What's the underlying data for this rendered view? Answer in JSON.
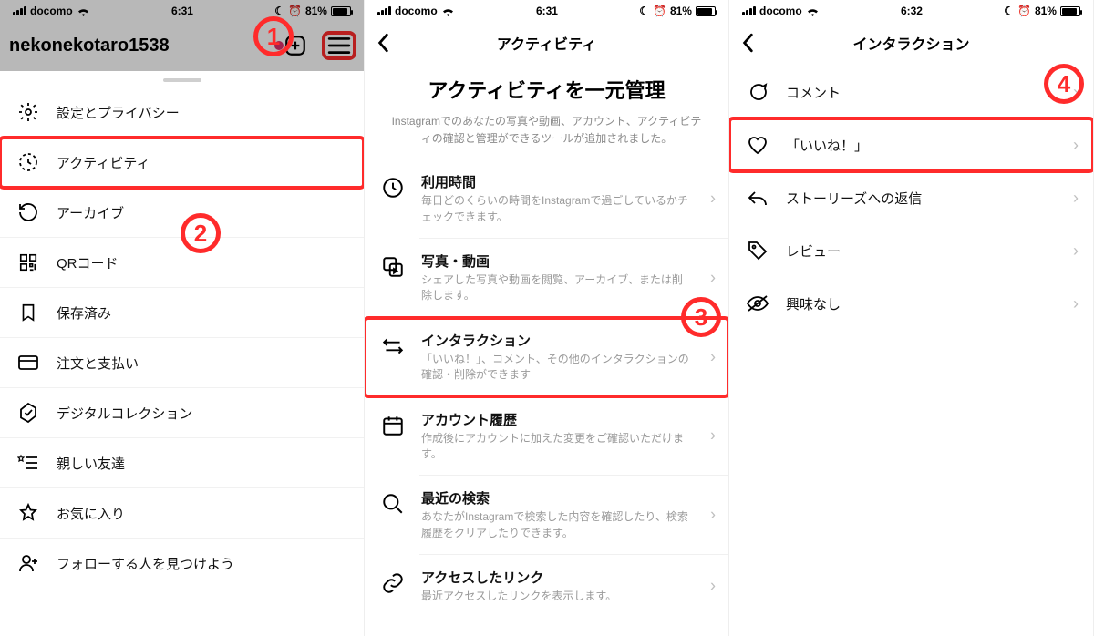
{
  "annotations": {
    "n1": "1",
    "n2": "2",
    "n3": "3",
    "n4": "4"
  },
  "pane1": {
    "status": {
      "carrier": "docomo",
      "time": "6:31",
      "battery": "81%"
    },
    "username": "nekonekotaro1538",
    "menu": [
      {
        "label": "設定とプライバシー"
      },
      {
        "label": "アクティビティ"
      },
      {
        "label": "アーカイブ"
      },
      {
        "label": "QRコード"
      },
      {
        "label": "保存済み"
      },
      {
        "label": "注文と支払い"
      },
      {
        "label": "デジタルコレクション"
      },
      {
        "label": "親しい友達"
      },
      {
        "label": "お気に入り"
      },
      {
        "label": "フォローする人を見つけよう"
      }
    ]
  },
  "pane2": {
    "status": {
      "carrier": "docomo",
      "time": "6:31",
      "battery": "81%"
    },
    "title": "アクティビティ",
    "hero_title": "アクティビティを一元管理",
    "hero_sub": "Instagramでのあなたの写真や動画、アカウント、アクティビティの確認と管理ができるツールが追加されました。",
    "rows": [
      {
        "title": "利用時間",
        "sub": "毎日どのくらいの時間をInstagramで過ごしているかチェックできます。"
      },
      {
        "title": "写真・動画",
        "sub": "シェアした写真や動画を閲覧、アーカイブ、または削除します。"
      },
      {
        "title": "インタラクション",
        "sub": "「いいね！」、コメント、その他のインタラクションの確認・削除ができます"
      },
      {
        "title": "アカウント履歴",
        "sub": "作成後にアカウントに加えた変更をご確認いただけます。"
      },
      {
        "title": "最近の検索",
        "sub": "あなたがInstagramで検索した内容を確認したり、検索履歴をクリアしたりできます。"
      },
      {
        "title": "アクセスしたリンク",
        "sub": "最近アクセスしたリンクを表示します。"
      }
    ]
  },
  "pane3": {
    "status": {
      "carrier": "docomo",
      "time": "6:32",
      "battery": "81%"
    },
    "title": "インタラクション",
    "rows": [
      {
        "label": "コメント"
      },
      {
        "label": "「いいね！」"
      },
      {
        "label": "ストーリーズへの返信"
      },
      {
        "label": "レビュー"
      },
      {
        "label": "興味なし"
      }
    ]
  }
}
